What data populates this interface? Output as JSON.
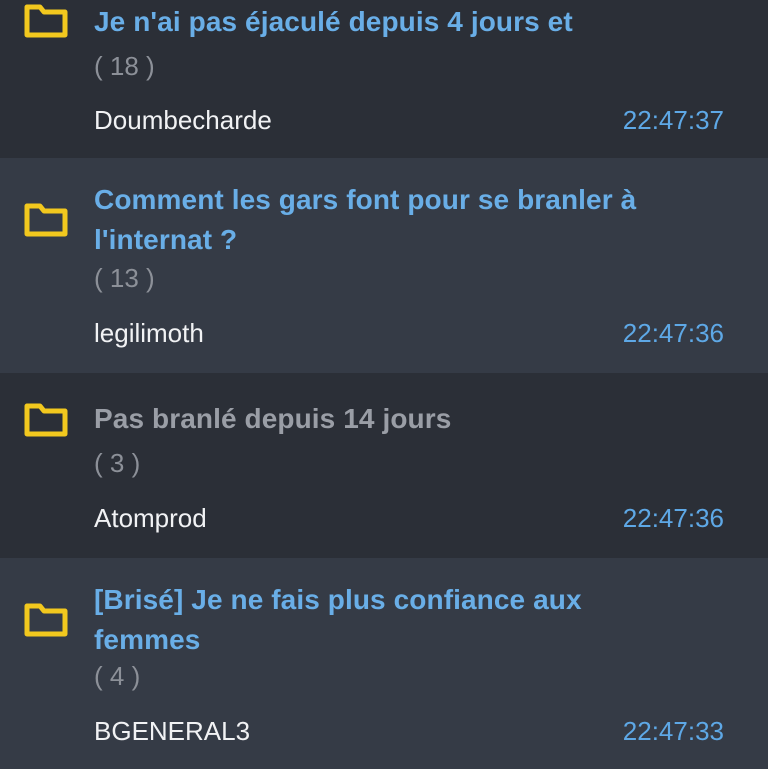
{
  "colors": {
    "folder_icon": "#f2c81e",
    "title_unread": "#69aee7",
    "title_read": "#9a9ea6",
    "timestamp": "#5ea8e6",
    "author": "#f1f2f4",
    "row_dark": "#2b2f37",
    "row_light": "#353b46"
  },
  "topics": [
    {
      "icon": "folder-icon",
      "title": "Je n'ai pas éjaculé depuis 4 jours et",
      "count": "( 18 )",
      "author": "Doumbecharde",
      "time": "22:47:37",
      "read": false
    },
    {
      "icon": "folder-icon",
      "title": "Comment les gars font pour se branler à\nl'internat ?",
      "count": "( 13 )",
      "author": "legilimoth",
      "time": "22:47:36",
      "read": false
    },
    {
      "icon": "folder-icon",
      "title": "Pas branlé depuis 14 jours",
      "count": "( 3 )",
      "author": "Atomprod",
      "time": "22:47:36",
      "read": true
    },
    {
      "icon": "folder-icon",
      "title": "[Brisé] Je ne fais plus confiance aux\nfemmes",
      "count": "( 4 )",
      "author": "BGENERAL3",
      "time": "22:47:33",
      "read": false
    }
  ]
}
